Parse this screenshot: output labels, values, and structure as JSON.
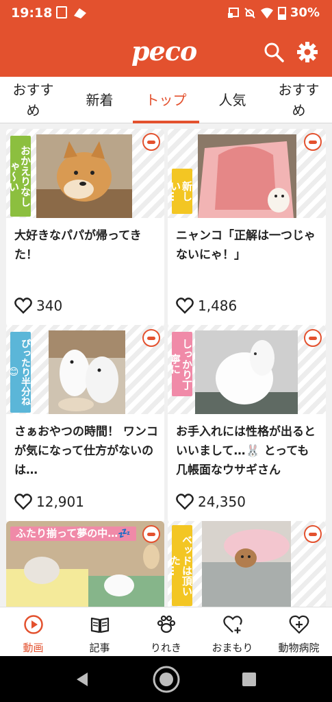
{
  "status_bar": {
    "time": "19:18",
    "battery": "30%"
  },
  "header": {
    "logo": "peco",
    "icons": [
      "search-icon",
      "gear-icon"
    ]
  },
  "tabs": [
    {
      "label": "おすすめ"
    },
    {
      "label": "新着"
    },
    {
      "label": "トップ",
      "active": true
    },
    {
      "label": "人気"
    },
    {
      "label": "おすすめ"
    }
  ],
  "cards": [
    {
      "tag": "おかえりなしゃ〜い",
      "title": "大好きなパパが帰ってきた！",
      "likes": "340",
      "tag_color": "#8cbf3f"
    },
    {
      "tag": "新しい…",
      "title": "ニャンコ「正解は一つじゃないにゃ！」",
      "likes": "1,486",
      "tag_color": "#f3c623"
    },
    {
      "tag": "ぴったり半分ね😊",
      "title": "さぁおやつの時間！ ワンコが気になって仕方がないのは…",
      "likes": "12,901",
      "tag_color": "#5bb6d8"
    },
    {
      "tag": "しっかり丁寧に",
      "title": "お手入れには性格が出るといいまして…🐰 とっても几帳面なウサギさん",
      "likes": "24,350",
      "tag_color": "#f08aa8"
    },
    {
      "tag": "ふたり揃って夢の中…💤",
      "title": "",
      "likes": "",
      "tag_color": "#f08aa8"
    },
    {
      "tag": "ベッドは頂いた…",
      "title": "",
      "likes": "",
      "tag_color": "#f3c623"
    }
  ],
  "bottom_nav": [
    {
      "label": "動画",
      "icon": "play-circle-icon",
      "active": true
    },
    {
      "label": "記事",
      "icon": "book-icon"
    },
    {
      "label": "りれき",
      "icon": "paw-icon"
    },
    {
      "label": "おまもり",
      "icon": "heart-plus-icon"
    },
    {
      "label": "動物病院",
      "icon": "heart-hospital-icon"
    }
  ],
  "colors": {
    "brand": "#e3512e"
  }
}
